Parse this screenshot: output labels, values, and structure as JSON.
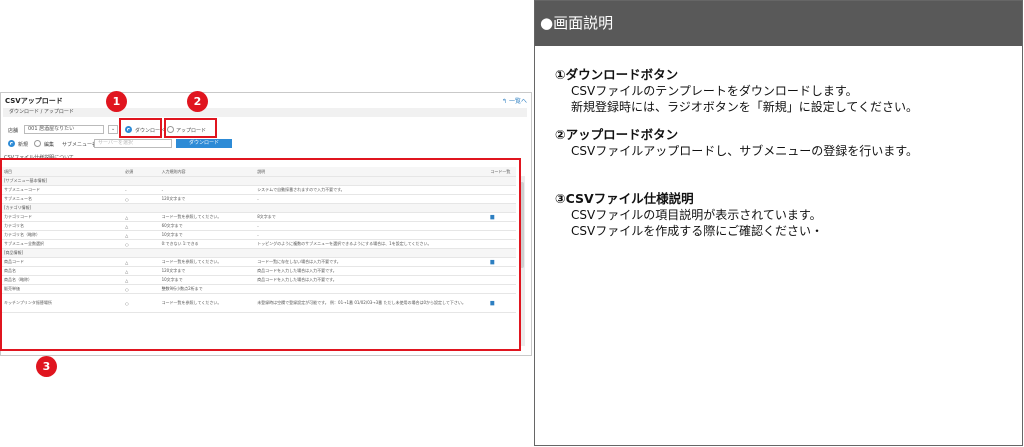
{
  "app": {
    "title": "CSVアップロード",
    "back_link": "一覧へ",
    "section_title": "ダウンロード / アップロード",
    "form_label": "店舗",
    "shop_select": "001 居酒屋なりたい",
    "radio_download": "ダウンロード",
    "radio_upload": "アップロード",
    "radio_new": "新規",
    "radio_edit": "編集",
    "submenu_label": "サブメニュー名",
    "submenu_placeholder": "サーバーを選択",
    "download_button": "ダウンロード",
    "csv_spec_title": "CSVファイル仕様説明について"
  },
  "table": {
    "headers": [
      "項目",
      "必須",
      "入力規則内容",
      "説明",
      "コード一覧"
    ],
    "rows": [
      {
        "type": "group",
        "cells": [
          "[サブメニュー基本情報]",
          "",
          "",
          "",
          ""
        ]
      },
      {
        "type": "row",
        "cells": [
          "サブメニューコード",
          "-",
          "-",
          "システムで自動採番されますので入力不要です。",
          ""
        ]
      },
      {
        "type": "row",
        "cells": [
          "サブメニュー名",
          "○",
          "120文字まで",
          "-",
          ""
        ]
      },
      {
        "type": "group",
        "cells": [
          "[カテゴリ情報]",
          "",
          "",
          "",
          ""
        ]
      },
      {
        "type": "row",
        "cells": [
          "カテゴリコード",
          "△",
          "コード一覧を参照してください。",
          "8文字まで",
          "book"
        ]
      },
      {
        "type": "row",
        "cells": [
          "カテゴリ名",
          "△",
          "60文字まで",
          "-",
          ""
        ]
      },
      {
        "type": "row",
        "cells": [
          "カテゴリ名（略称）",
          "△",
          "10文字まで",
          "-",
          ""
        ]
      },
      {
        "type": "row",
        "cells": [
          "サブメニュー全数選択",
          "○",
          "0:できない 1:できる",
          "トッピングのように複数のサブメニューを選択できるようにする場合は、1を設定してください。",
          ""
        ]
      },
      {
        "type": "group",
        "cells": [
          "[商品情報]",
          "",
          "",
          "",
          ""
        ]
      },
      {
        "type": "row",
        "cells": [
          "商品コード",
          "△",
          "コード一覧を参照してください。",
          "コード一覧に存在しない場合は入力不要です。",
          "book"
        ]
      },
      {
        "type": "row",
        "cells": [
          "商品名",
          "△",
          "120文字まで",
          "商品コードを入力した場合は入力不要です。",
          ""
        ]
      },
      {
        "type": "row",
        "cells": [
          "商品名（略称）",
          "△",
          "10文字まで",
          "商品コードを入力した場合は入力不要です。",
          ""
        ]
      },
      {
        "type": "row",
        "cells": [
          "販売単価",
          "○",
          "整数9桁小数点2桁まで",
          "",
          ""
        ]
      },
      {
        "type": "tall",
        "cells": [
          "キッチンプリンタ振替場所",
          "○",
          "コード一覧を参照してください。",
          "未登録時は空欄で登録設定が可能です。 例：01→1番 01/02/03→3番 ただし未使用の場合は0から設定して下さい。",
          "book"
        ]
      }
    ]
  },
  "annotations": [
    "1",
    "2",
    "3"
  ],
  "panel": {
    "header": "●画面説明",
    "items": [
      {
        "title": "①ダウンロードボタン",
        "lines": [
          "CSVファイルのテンプレートをダウンロードします。",
          "新規登録時には、ラジオボタンを「新規」に設定してください。"
        ]
      },
      {
        "title": "②アップロードボタン",
        "lines": [
          "CSVファイルアップロードし、サブメニューの登録を行います。"
        ]
      },
      {
        "title": "③CSVファイル仕様説明",
        "lines": [
          "CSVファイルの項目説明が表示されています。",
          "CSVファイルを作成する際にご確認ください・"
        ]
      }
    ]
  },
  "colors": {
    "annotation_red": "#e0151f",
    "accent_blue": "#2d8bd6",
    "panel_header": "#595959"
  }
}
